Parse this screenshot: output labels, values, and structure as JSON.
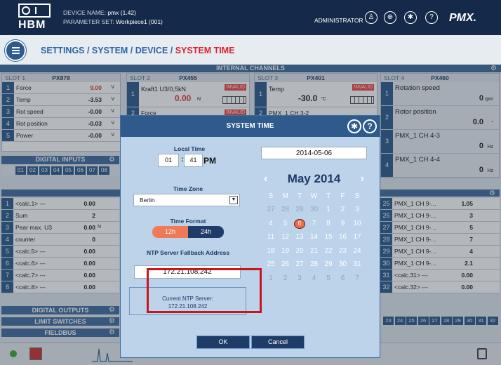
{
  "header": {
    "logo_text": "HBM",
    "device_name_label": "DEVICE NAME:",
    "device_name_value": "pmx (1.42)",
    "parameter_set_label": "PARAMETER SET:",
    "parameter_set_value": "Workpiece1 (001)",
    "user": "ADMINISTRATOR",
    "brand": "PMX."
  },
  "breadcrumb": {
    "part1": "SETTINGS / SYSTEM / DEVICE / ",
    "current": "SYSTEM TIME"
  },
  "background": {
    "internal_channels": "INTERNAL CHANNELS",
    "slots": [
      {
        "slot": "SLOT 1",
        "module": "PX878"
      },
      {
        "slot": "SLOT 2",
        "module": "PX455"
      },
      {
        "slot": "SLOT 3",
        "module": "PX401"
      },
      {
        "slot": "SLOT 4",
        "module": "PX460"
      }
    ],
    "slot1_rows": [
      {
        "n": "1",
        "label": "Force",
        "value": "9.00",
        "unit": "V"
      },
      {
        "n": "2",
        "label": "Temp",
        "value": "-3.53",
        "unit": "V"
      },
      {
        "n": "3",
        "label": "Rot speed",
        "value": "-0.00",
        "unit": "V"
      },
      {
        "n": "4",
        "label": "Rot position",
        "value": "-0.03",
        "unit": "V"
      },
      {
        "n": "5",
        "label": "Power",
        "value": "-0.00",
        "unit": "V"
      }
    ],
    "slot2_label": "Kraft1 U3/0,5kN",
    "slot2_value": "0.00",
    "slot2_unit": "N",
    "slot2_row2": "Force",
    "invalid": "INVALID",
    "slot3_label": "Temp",
    "slot3_value": "-30.0",
    "slot3_unit": "°C",
    "slot3_row2": "PMX_1 CH 3-2",
    "slot4_rows": [
      {
        "n": "1",
        "label": "Rotation speed",
        "value": "0",
        "unit": "rpm"
      },
      {
        "n": "2",
        "label": "Rotor position",
        "value": "0.0",
        "unit": "°"
      },
      {
        "n": "3",
        "label": "PMX_1 CH 4-3",
        "value": "0",
        "unit": "Hz"
      },
      {
        "n": "4",
        "label": "PMX_1 CH 4-4",
        "value": "0",
        "unit": "Hz"
      }
    ],
    "digital_inputs": "DIGITAL INPUTS",
    "di_numbers": [
      "01",
      "02",
      "03",
      "04",
      "05",
      "06",
      "07",
      "08"
    ],
    "calc_rows": [
      {
        "n": "1",
        "label": "<calc.1> ---",
        "value": "0.00"
      },
      {
        "n": "2",
        "label": "Sum",
        "value": "2"
      },
      {
        "n": "3",
        "label": "Pear max. U3",
        "value": "0.00",
        "unit": "N"
      },
      {
        "n": "4",
        "label": "counter",
        "value": "0"
      },
      {
        "n": "5",
        "label": "<calc.5> ---",
        "value": "0.00"
      },
      {
        "n": "6",
        "label": "<calc.6> ---",
        "value": "0.00"
      },
      {
        "n": "7",
        "label": "<calc.7> ---",
        "value": "0.00"
      },
      {
        "n": "8",
        "label": "<calc.8> ---",
        "value": "0.00"
      }
    ],
    "right_rows": [
      {
        "n": "25",
        "label": "PMX_1 CH 9-...",
        "value": "1.05"
      },
      {
        "n": "26",
        "label": "PMX_1 CH 9-...",
        "value": "3"
      },
      {
        "n": "27",
        "label": "PMX_1 CH 9-...",
        "value": "5"
      },
      {
        "n": "28",
        "label": "PMX_1 CH 9-...",
        "value": "7"
      },
      {
        "n": "29",
        "label": "PMX_1 CH 9-...",
        "value": "4"
      },
      {
        "n": "30",
        "label": "PMX_1 CH 9-...",
        "value": "2.1"
      },
      {
        "n": "31",
        "label": "<calc.31> ---",
        "value": "0.00"
      },
      {
        "n": "32",
        "label": "<calc.32> ---",
        "value": "0.00"
      }
    ],
    "digital_outputs": "DIGITAL OUTPUTS",
    "limit_switches": "LIMIT SWITCHES",
    "fieldbus": "FIELDBUS",
    "ls_numbers": [
      "23",
      "24",
      "25",
      "26",
      "27",
      "28",
      "29",
      "30",
      "31",
      "32"
    ]
  },
  "dialog": {
    "title": "SYSTEM TIME",
    "local_time_label": "Local Time",
    "hour": "01",
    "minute": "41",
    "time_sep": ":",
    "ampm": "PM",
    "time_zone_label": "Time Zone",
    "time_zone_value": "Berlin",
    "time_format_label": "Time Format",
    "format_12": "12h",
    "format_24": "24h",
    "ntp_fallback_label": "NTP Server Fallback Address",
    "ntp_fallback_value": "172.21.108.242",
    "current_ntp_label": "Current NTP Server:",
    "current_ntp_value": "172.21.108.242",
    "date_value": "2014-05-06",
    "calendar_month": "May 2014",
    "prev": "‹",
    "next": "›",
    "weekdays": [
      "S",
      "M",
      "T",
      "W",
      "T",
      "F",
      "S"
    ],
    "weeks": [
      [
        "27",
        "28",
        "29",
        "30",
        "1",
        "2",
        "3"
      ],
      [
        "4",
        "5",
        "6",
        "7",
        "8",
        "9",
        "10"
      ],
      [
        "11",
        "12",
        "13",
        "14",
        "15",
        "16",
        "17"
      ],
      [
        "18",
        "19",
        "20",
        "21",
        "22",
        "23",
        "24"
      ],
      [
        "25",
        "26",
        "27",
        "28",
        "29",
        "30",
        "31"
      ],
      [
        "1",
        "2",
        "3",
        "4",
        "5",
        "6",
        "7"
      ]
    ],
    "selected_day": "6",
    "ok": "OK",
    "cancel": "Cancel"
  },
  "colors": {
    "header_bg": "#152a4a",
    "accent_blue": "#2f64a3",
    "breadcrumb_current": "#d9232d",
    "dialog_bg": "#bcd3ea",
    "selected_day": "#ee6a47",
    "highlight": "#c8161d"
  }
}
